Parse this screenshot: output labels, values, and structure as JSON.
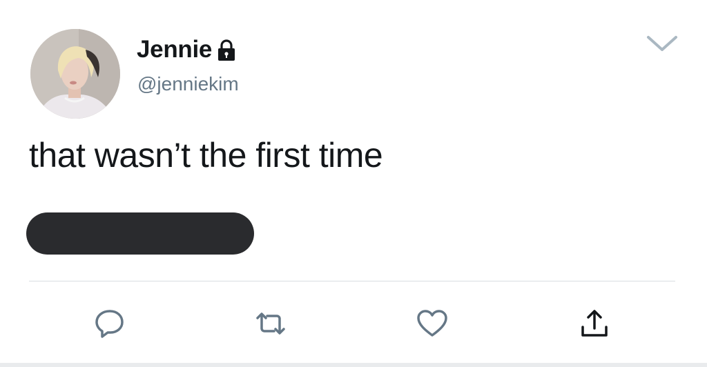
{
  "user": {
    "display_name": "Jennie",
    "handle": "@jenniekim",
    "protected": true
  },
  "tweet": {
    "text": "that wasn’t the first time"
  },
  "icons": {
    "lock": "lock-icon",
    "menu": "chevron-down-icon",
    "reply": "reply-icon",
    "retweet": "retweet-icon",
    "like": "heart-icon",
    "share": "share-icon"
  },
  "colors": {
    "text_primary": "#14171a",
    "text_secondary": "#657786",
    "icon_gray": "#657786",
    "redaction_bar": "#2a2b2e",
    "divider": "#d8dde1"
  }
}
